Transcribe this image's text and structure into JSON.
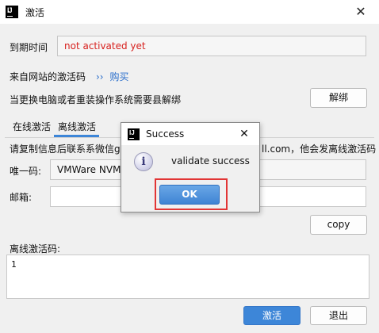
{
  "window": {
    "title": "激活",
    "close_glyph": "✕",
    "app_icon_text": "IJ"
  },
  "expire": {
    "label": "到期时间",
    "value": "not activated yet",
    "value_color": "#d7211e"
  },
  "website": {
    "label": "来自网站的激活码",
    "link_prefix": "››",
    "link_text": "购买",
    "link_color": "#2a6ecb"
  },
  "unbind": {
    "note": "当更换电脑或者重装操作系统需要县解绑",
    "button": "解绑"
  },
  "tabs": [
    {
      "label": "在线激活"
    },
    {
      "label": "离线激活",
      "active": true
    }
  ],
  "offline": {
    "instruction_left": "请复制信息后联系系微信geju",
    "instruction_right": "ll.com，他会发离线激活码",
    "unique_label": "唯一码:",
    "unique_value": "VMWare NVM",
    "email_label": "邮箱:",
    "email_value": "",
    "copy_button": "copy",
    "code_label": "离线激活码:",
    "code_value": "1"
  },
  "footer": {
    "activate_button": "激活",
    "exit_button": "退出",
    "accent": "#3d86d8"
  },
  "dialog": {
    "title": "Success",
    "close_glyph": "✕",
    "icon": "info-icon",
    "icon_glyph": "i",
    "message": "validate success",
    "ok_button": "OK",
    "highlight_color": "#e23535"
  }
}
